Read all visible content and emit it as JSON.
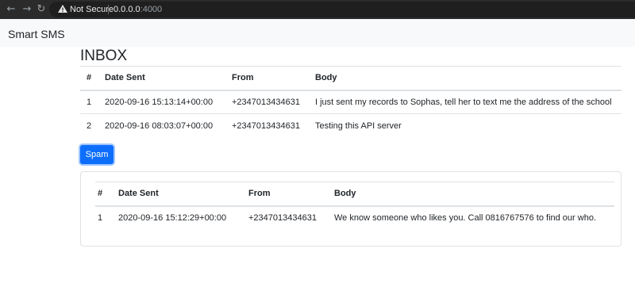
{
  "browser": {
    "security_label": "Not Secure",
    "url_host": "0.0.0.0",
    "url_port": ":4000"
  },
  "app": {
    "brand": "Smart SMS"
  },
  "inbox": {
    "title": "INBOX",
    "columns": [
      "#",
      "Date Sent",
      "From",
      "Body"
    ],
    "rows": [
      [
        "1",
        "2020-09-16 15:13:14+00:00",
        "+2347013434631",
        "I just sent my records to Sophas, tell her to text me the address of the school"
      ],
      [
        "2",
        "2020-09-16 08:03:07+00:00",
        "+2347013434631",
        "Testing this API server"
      ]
    ]
  },
  "spam": {
    "button_label": "Spam",
    "columns": [
      "#",
      "Date Sent",
      "From",
      "Body"
    ],
    "rows": [
      [
        "1",
        "2020-09-16 15:12:29+00:00",
        "+2347013434631",
        "We know someone who likes you. Call 0816767576 to find our who."
      ]
    ]
  },
  "colors": {
    "primary": "#0d6efd",
    "navbar_bg": "#f8f9fa",
    "chrome_bg": "#2b2b2b"
  }
}
